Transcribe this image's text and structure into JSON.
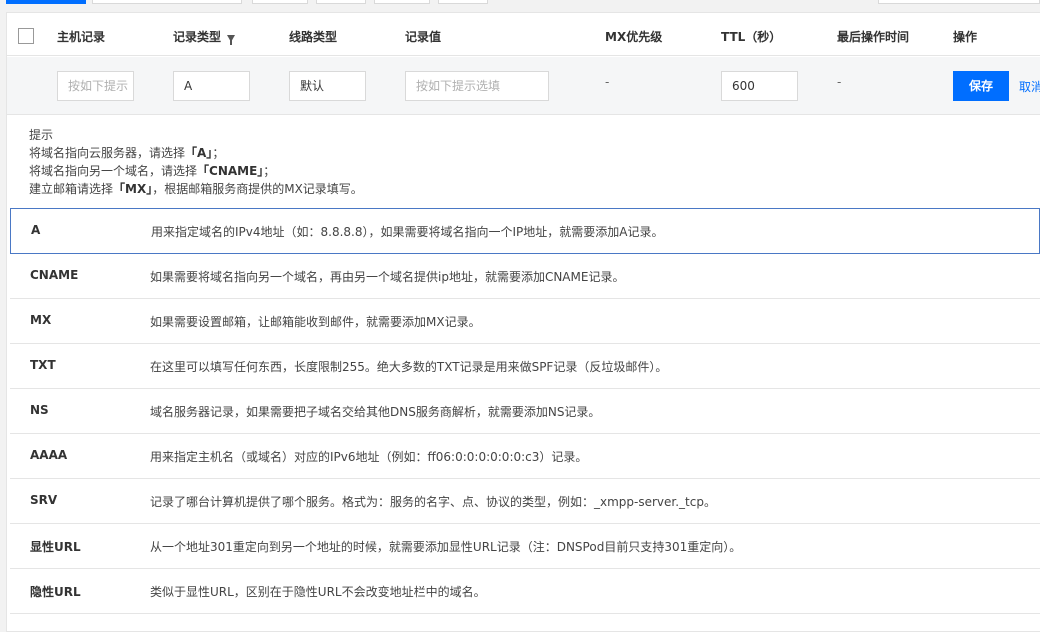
{
  "table_headers": {
    "host": "主机记录",
    "type": "记录类型",
    "line": "线路类型",
    "value": "记录值",
    "mx": "MX优先级",
    "ttl": "TTL（秒）",
    "last_op": "最后操作时间",
    "action": "操作"
  },
  "edit_row": {
    "host_placeholder": "按如下提示",
    "type_value": "A",
    "line_value": "默认",
    "value_placeholder": "按如下提示选填",
    "mx_value": "-",
    "ttl_value": "600",
    "last_op_value": "-",
    "save_label": "保存",
    "cancel_label": "取消"
  },
  "hint": {
    "title": "提示",
    "line1_pre": "将域名指向云服务器，请选择",
    "line1_key": "「A」",
    "line1_post": "；",
    "line2_pre": "将域名指向另一个域名，请选择",
    "line2_key": "「CNAME」",
    "line2_post": "；",
    "line3_pre": "建立邮箱请选择",
    "line3_key": "「MX」",
    "line3_post": "，根据邮箱服务商提供的MX记录填写。"
  },
  "record_types": [
    {
      "name": "A",
      "desc": "用来指定域名的IPv4地址（如：8.8.8.8），如果需要将域名指向一个IP地址，就需要添加A记录。"
    },
    {
      "name": "CNAME",
      "desc": "如果需要将域名指向另一个域名，再由另一个域名提供ip地址，就需要添加CNAME记录。"
    },
    {
      "name": "MX",
      "desc": "如果需要设置邮箱，让邮箱能收到邮件，就需要添加MX记录。"
    },
    {
      "name": "TXT",
      "desc": "在这里可以填写任何东西，长度限制255。绝大多数的TXT记录是用来做SPF记录（反垃圾邮件）。"
    },
    {
      "name": "NS",
      "desc": "域名服务器记录，如果需要把子域名交给其他DNS服务商解析，就需要添加NS记录。"
    },
    {
      "name": "AAAA",
      "desc": "用来指定主机名（或域名）对应的IPv6地址（例如：ff06:0:0:0:0:0:0:c3）记录。"
    },
    {
      "name": "SRV",
      "desc": "记录了哪台计算机提供了哪个服务。格式为：服务的名字、点、协议的类型，例如：_xmpp-server._tcp。"
    },
    {
      "name": "显性URL",
      "desc": "从一个地址301重定向到另一个地址的时候，就需要添加显性URL记录（注：DNSPod目前只支持301重定向）。"
    },
    {
      "name": "隐性URL",
      "desc": "类似于显性URL，区别在于隐性URL不会改变地址栏中的域名。"
    }
  ],
  "colors": {
    "primary": "#006eff",
    "selected_border": "#4a78c5"
  }
}
